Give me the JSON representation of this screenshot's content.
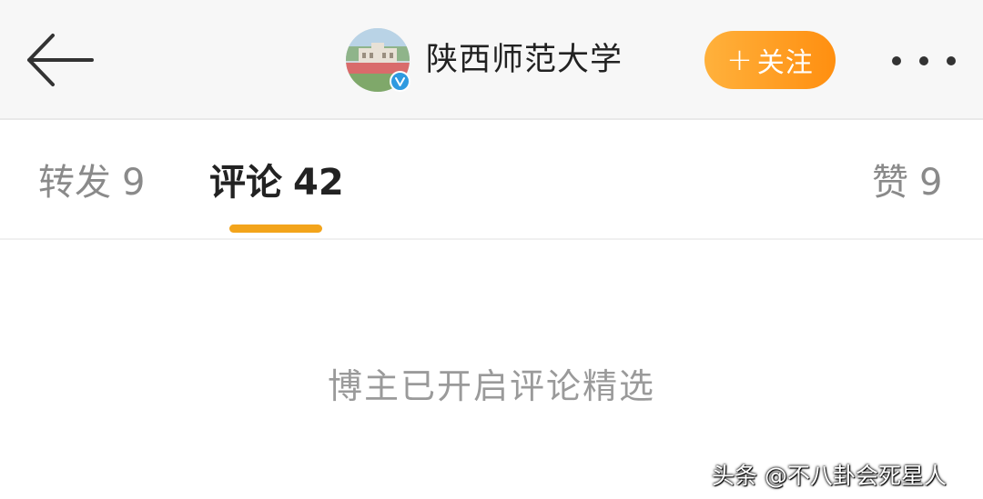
{
  "header": {
    "back_icon": "back-arrow-icon",
    "account_name": "陕西师范大学",
    "verified_icon": "verified-badge-icon",
    "follow_plus": "+",
    "follow_label": "关注",
    "more_icon": "more-dots-icon",
    "accent_color": "#ff9a1f"
  },
  "tabs": [
    {
      "label": "转发",
      "count": "9"
    },
    {
      "label": "评论",
      "count": "42"
    },
    {
      "label": "赞",
      "count": "9"
    }
  ],
  "active_tab": "评论",
  "indicator_color": "#f3a41b",
  "content": {
    "empty_message": "博主已开启评论精选"
  },
  "watermark": "头条 @不八卦会死星人"
}
